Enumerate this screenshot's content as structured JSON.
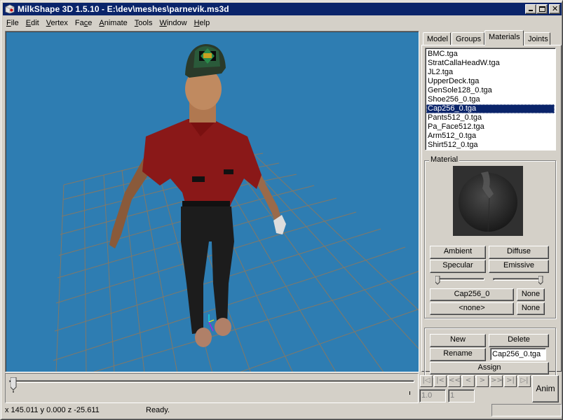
{
  "window": {
    "title": "MilkShape 3D 1.5.10 - E:\\dev\\meshes\\parnevik.ms3d",
    "minimize_glyph": "_",
    "maximize_glyph": "□",
    "close_glyph": "×"
  },
  "menubar": {
    "items": [
      {
        "label": "File",
        "accel": "F",
        "rest": "ile"
      },
      {
        "label": "Edit",
        "accel": "E",
        "rest": "dit"
      },
      {
        "label": "Vertex",
        "accel": "V",
        "rest": "ertex"
      },
      {
        "label": "Face",
        "pre": "Fa",
        "accel": "c",
        "rest": "e"
      },
      {
        "label": "Animate",
        "accel": "A",
        "rest": "nimate"
      },
      {
        "label": "Tools",
        "accel": "T",
        "rest": "ools"
      },
      {
        "label": "Window",
        "accel": "W",
        "rest": "indow"
      },
      {
        "label": "Help",
        "accel": "H",
        "rest": "elp"
      }
    ]
  },
  "viewport": {
    "background": "#2e7db2",
    "grid_color": "#8a7860",
    "subject": "3D character model (golfer in red polo, dark trousers, green cap)"
  },
  "tabs": [
    {
      "label": "Model",
      "active": false
    },
    {
      "label": "Groups",
      "active": false
    },
    {
      "label": "Materials",
      "active": true
    },
    {
      "label": "Joints",
      "active": false
    }
  ],
  "materials": {
    "list": [
      "BMC.tga",
      "StratCallaHeadW.tga",
      "JL2.tga",
      "UpperDeck.tga",
      "GenSole128_0.tga",
      "Shoe256_0.tga",
      "Cap256_0.tga",
      "Pants512_0.tga",
      "Pa_Face512.tga",
      "Arm512_0.tga",
      "Shirt512_0.tga"
    ],
    "selected_index": 6,
    "group_label": "Material",
    "buttons": {
      "ambient": "Ambient",
      "diffuse": "Diffuse",
      "specular": "Specular",
      "emissive": "Emissive",
      "texture1": "Cap256_0",
      "texture1_none": "None",
      "texture2": "<none>",
      "texture2_none": "None",
      "new": "New",
      "delete": "Delete",
      "rename": "Rename",
      "assign": "Assign"
    },
    "shininess_slider": 0.0,
    "transparency_slider": 1.0,
    "name_field": "Cap256_0.tga"
  },
  "animation": {
    "frame_slider": 0.0,
    "nav_buttons": [
      "first-frame",
      "prev-key",
      "rewind",
      "prev",
      "next",
      "forward",
      "next-key",
      "last-frame"
    ],
    "nav_glyphs": [
      "|◁",
      "|<",
      "<<",
      "<",
      ">",
      ">>",
      ">|",
      "▷|"
    ],
    "speed_field": "1.0",
    "frame_field": "1",
    "anim_button": "Anim"
  },
  "statusbar": {
    "coords": "x 145.011 y 0.000 z -25.611",
    "message": "Ready."
  }
}
